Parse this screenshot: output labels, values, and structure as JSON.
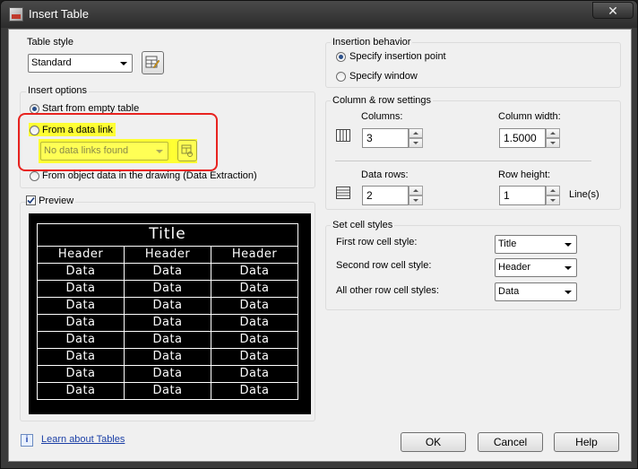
{
  "window": {
    "title": "Insert Table",
    "close_glyph": "✕"
  },
  "table_style": {
    "label": "Table style",
    "value": "Standard"
  },
  "insert_options": {
    "label": "Insert options",
    "empty_table": "Start from empty table",
    "data_link": "From a data link",
    "data_link_combo": "No data links found",
    "object_data": "From object data in the drawing (Data Extraction)"
  },
  "preview": {
    "label": "Preview",
    "title": "Title",
    "headers": [
      "Header",
      "Header",
      "Header"
    ],
    "rows": [
      [
        "Data",
        "Data",
        "Data"
      ],
      [
        "Data",
        "Data",
        "Data"
      ],
      [
        "Data",
        "Data",
        "Data"
      ],
      [
        "Data",
        "Data",
        "Data"
      ],
      [
        "Data",
        "Data",
        "Data"
      ],
      [
        "Data",
        "Data",
        "Data"
      ],
      [
        "Data",
        "Data",
        "Data"
      ],
      [
        "Data",
        "Data",
        "Data"
      ]
    ]
  },
  "insertion": {
    "label": "Insertion behavior",
    "insertion_point": "Specify insertion point",
    "window": "Specify window"
  },
  "colrow": {
    "label": "Column & row settings",
    "columns_label": "Columns:",
    "columns_value": "3",
    "col_width_label": "Column width:",
    "col_width_value": "1.5000",
    "data_rows_label": "Data rows:",
    "data_rows_value": "2",
    "row_height_label": "Row height:",
    "row_height_value": "1",
    "lines_label": "Line(s)"
  },
  "cell_styles": {
    "label": "Set cell styles",
    "first_label": "First row cell style:",
    "first_value": "Title",
    "second_label": "Second row cell style:",
    "second_value": "Header",
    "other_label": "All other row cell styles:",
    "other_value": "Data"
  },
  "footer": {
    "info_glyph": "i",
    "learn_link": "Learn about Tables",
    "ok": "OK",
    "cancel": "Cancel",
    "help": "Help"
  },
  "colors": {
    "highlight": "#ffff33",
    "annotation_red": "#e8231f"
  }
}
